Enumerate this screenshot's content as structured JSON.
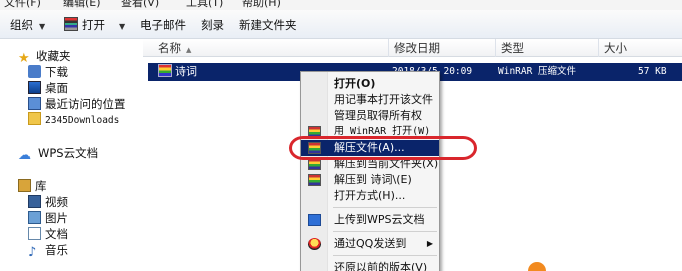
{
  "menubar": {
    "items": [
      "文件(F)",
      "编辑(E)",
      "查看(V)",
      "工具(T)",
      "帮助(H)"
    ]
  },
  "toolbar": {
    "organize": "组织",
    "open": "打开",
    "email": "电子邮件",
    "burn": "刻录",
    "new_folder": "新建文件夹"
  },
  "sidebar": {
    "favorites": "收藏夹",
    "downloads": "下载",
    "desktop": "桌面",
    "recent": "最近访问的位置",
    "folder_2345": "2345Downloads",
    "wps_cloud": "WPS云文档",
    "library": "库",
    "videos": "视频",
    "pictures": "图片",
    "documents": "文档",
    "music": "音乐"
  },
  "columns": {
    "name": "名称",
    "modified": "修改日期",
    "type": "类型",
    "size": "大小"
  },
  "file": {
    "name": "诗词",
    "modified": "2018/3/5 20:09",
    "type": "WinRAR 压缩文件",
    "size": "57 KB"
  },
  "context_menu": {
    "open": "打开(O)",
    "open_notepad": "用记事本打开该文件",
    "take_ownership": "管理员取得所有权",
    "open_winrar": "用 WinRAR 打开(W)",
    "extract_files": "解压文件(A)...",
    "extract_here": "解压到当前文件夹(X)",
    "extract_to": "解压到 诗词\\(E)",
    "open_with": "打开方式(H)...",
    "upload_wps": "上传到WPS云文档",
    "send_qq": "通过QQ发送到",
    "restore": "还原以前的版本(V)"
  },
  "colors": {
    "selection": "#0a246a",
    "annotation": "#d9262c"
  }
}
